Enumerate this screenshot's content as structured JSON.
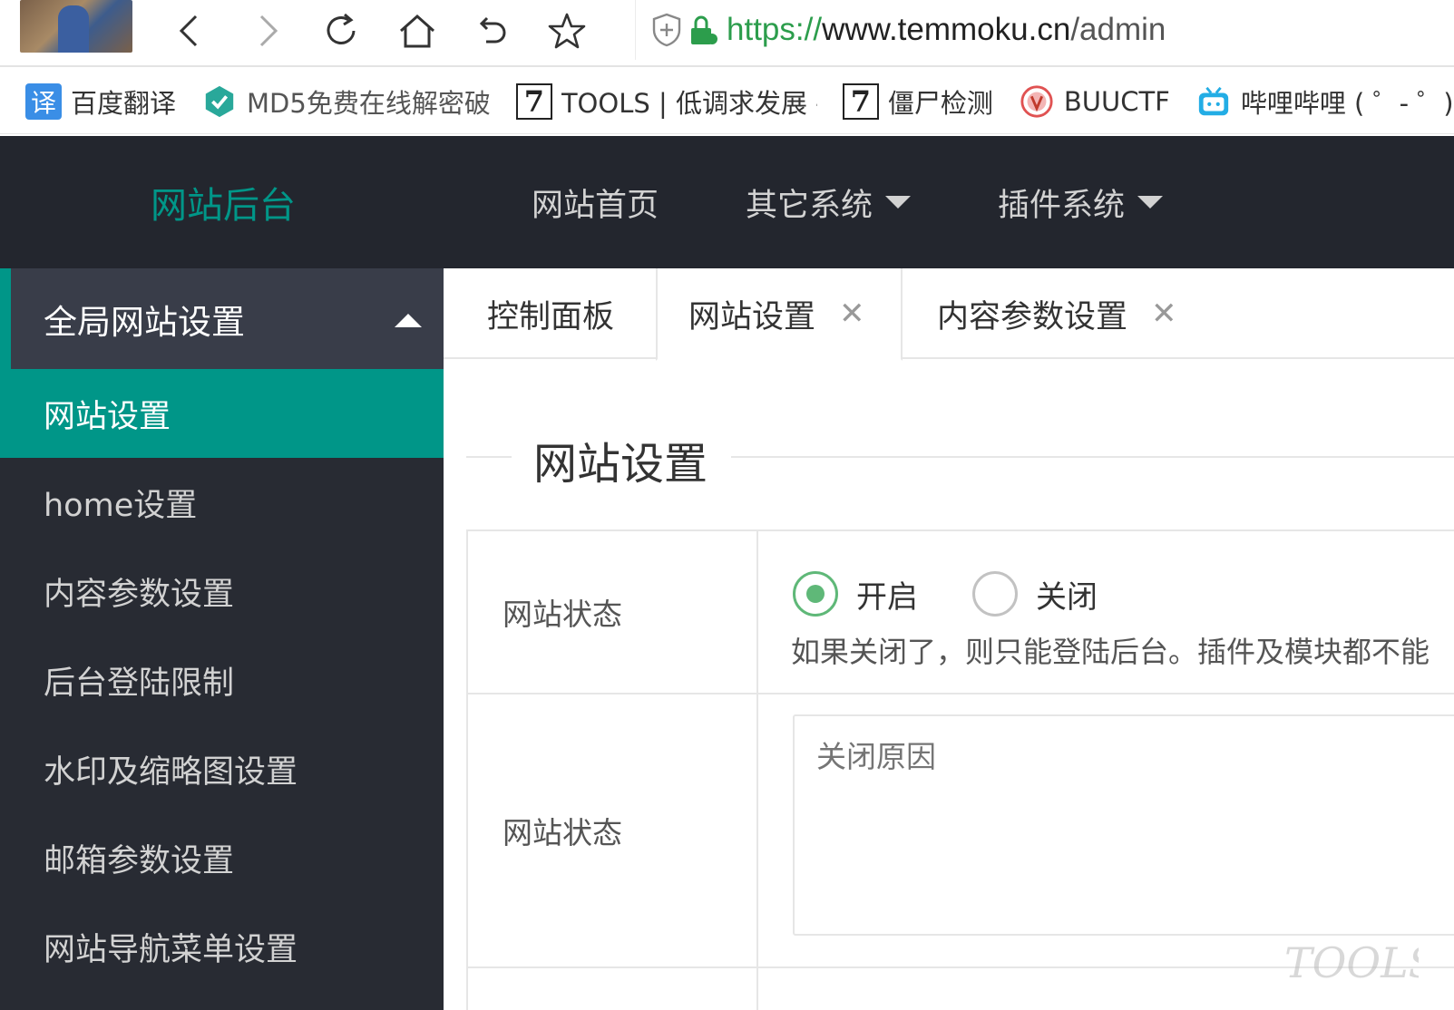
{
  "browser": {
    "url_protocol": "https://",
    "url_host": "www.temmoku.cn",
    "url_path": "/admin"
  },
  "bookmarks": [
    {
      "label": "百度翻译",
      "icon": "baidu-translate-icon",
      "icon_text": "译",
      "color": "#3a8ee6"
    },
    {
      "label": "MD5免费在线解密破",
      "icon": "md5-icon",
      "color": "#29a89a"
    },
    {
      "label": "TOOLS | 低调求发展 -",
      "icon": "tools-icon",
      "icon_text": "7"
    },
    {
      "label": "僵尸检测",
      "icon": "tools-icon",
      "icon_text": "7"
    },
    {
      "label": "BUUCTF",
      "icon": "buuctf-icon",
      "color": "#e05252"
    },
    {
      "label": "哔哩哔哩 ( ゜- ゜)つロ",
      "icon": "bilibili-icon",
      "color": "#23ade5"
    }
  ],
  "header": {
    "logo": "网站后台",
    "nav": [
      {
        "label": "网站首页",
        "dropdown": false
      },
      {
        "label": "其它系统",
        "dropdown": true
      },
      {
        "label": "插件系统",
        "dropdown": true
      }
    ]
  },
  "sidebar": {
    "group_title": "全局网站设置",
    "items": [
      {
        "label": "网站设置",
        "active": true
      },
      {
        "label": "home设置",
        "active": false
      },
      {
        "label": "内容参数设置",
        "active": false
      },
      {
        "label": "后台登陆限制",
        "active": false
      },
      {
        "label": "水印及缩略图设置",
        "active": false
      },
      {
        "label": "邮箱参数设置",
        "active": false
      },
      {
        "label": "网站导航菜单设置",
        "active": false
      }
    ]
  },
  "tabs": [
    {
      "label": "控制面板",
      "closable": false
    },
    {
      "label": "网站设置",
      "closable": true,
      "active": true
    },
    {
      "label": "内容参数设置",
      "closable": true
    }
  ],
  "tab_close_glyph": "✕",
  "main": {
    "section_title": "网站设置",
    "rows": [
      {
        "label": "网站状态",
        "options": [
          {
            "label": "开启",
            "checked": true
          },
          {
            "label": "关闭",
            "checked": false
          }
        ],
        "hint": "如果关闭了，则只能登陆后台。插件及模块都不能"
      },
      {
        "label": "网站状态",
        "placeholder": "关闭原因"
      }
    ]
  },
  "watermark": "TOOLS",
  "colors": {
    "accent": "#009688",
    "header_bg": "#23262e",
    "sidebar_bg": "#282b33",
    "radio_checked": "#5fb878",
    "url_green": "#2c9d4c"
  }
}
